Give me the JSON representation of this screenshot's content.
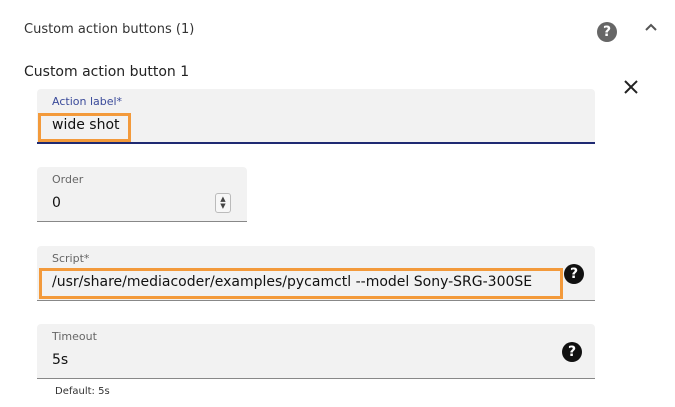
{
  "section": {
    "title": "Custom action buttons (1)"
  },
  "button": {
    "title": "Custom action button 1"
  },
  "fields": {
    "action_label": {
      "label": "Action label*",
      "value": "wide shot"
    },
    "order": {
      "label": "Order",
      "value": "0"
    },
    "script": {
      "label": "Script*",
      "value": "/usr/share/mediacoder/examples/pycamctl --model Sony-SRG-300SE"
    },
    "timeout": {
      "label": "Timeout",
      "value": "5s",
      "helper": "Default: 5s"
    }
  },
  "icons": {
    "help": "?",
    "collapse": "chevron-up-icon",
    "close": "close-icon"
  },
  "colors": {
    "highlight": "#f39a3b",
    "focus_underline": "#1f2a72",
    "field_bg": "#f2f2f2"
  }
}
